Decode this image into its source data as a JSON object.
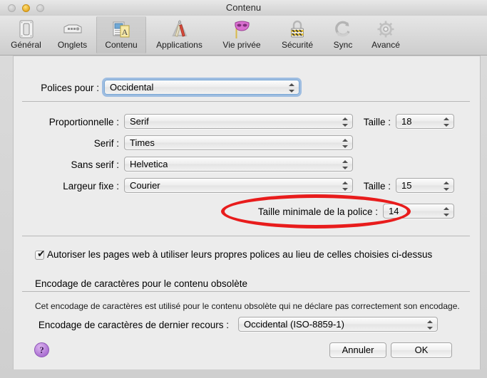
{
  "window": {
    "title": "Contenu",
    "traffic_lights": [
      "close",
      "minimize",
      "zoom"
    ]
  },
  "toolbar": {
    "items": [
      {
        "label": "Général",
        "icon": "toggle-switch-icon",
        "selected": false
      },
      {
        "label": "Onglets",
        "icon": "tabs-icon",
        "selected": false
      },
      {
        "label": "Contenu",
        "icon": "content-pages-icon",
        "selected": true
      },
      {
        "label": "Applications",
        "icon": "pencil-ruler-icon",
        "selected": false
      },
      {
        "label": "Vie privée",
        "icon": "mask-icon",
        "selected": false
      },
      {
        "label": "Sécurité",
        "icon": "padlock-icon",
        "selected": false
      },
      {
        "label": "Sync",
        "icon": "sync-arrows-icon",
        "selected": false
      },
      {
        "label": "Avancé",
        "icon": "gear-icon",
        "selected": false
      }
    ]
  },
  "fonts_section": {
    "fonts_for_label": "Polices pour :",
    "fonts_for_value": "Occidental",
    "rows": [
      {
        "label": "Proportionnelle :",
        "value": "Serif",
        "size_label": "Taille :",
        "size_value": "18"
      },
      {
        "label": "Serif :",
        "value": "Times",
        "size_label": "",
        "size_value": ""
      },
      {
        "label": "Sans serif :",
        "value": "Helvetica",
        "size_label": "",
        "size_value": ""
      },
      {
        "label": "Largeur fixe :",
        "value": "Courier",
        "size_label": "Taille :",
        "size_value": "15"
      }
    ],
    "minimum_size_label": "Taille minimale de la police :",
    "minimum_size_value": "14"
  },
  "allow_fonts": {
    "checked": true,
    "check_glyph": "✔",
    "label": "Autoriser les pages web à utiliser leurs propres polices au lieu de celles choisies ci-dessus"
  },
  "encoding_section": {
    "title": "Encodage de caractères pour le contenu obsolète",
    "description": "Cet encodage de caractères est utilisé pour le contenu obsolète qui ne déclare pas correctement son encodage.",
    "fallback_label": "Encodage de caractères de dernier recours :",
    "fallback_value": "Occidental (ISO-8859-1)"
  },
  "footer": {
    "help_glyph": "?",
    "cancel_label": "Annuler",
    "ok_label": "OK"
  },
  "annotation": {
    "shape": "ellipse",
    "color": "#e81c1c",
    "targets": "Taille minimale de la police : 14"
  },
  "colors": {
    "panel_bg": "#ececec",
    "toolbar_bg": "#dedede",
    "annotation_red": "#e81c1c",
    "focus_blue": "#5e98d8",
    "help_purple": "#b27ad6"
  }
}
